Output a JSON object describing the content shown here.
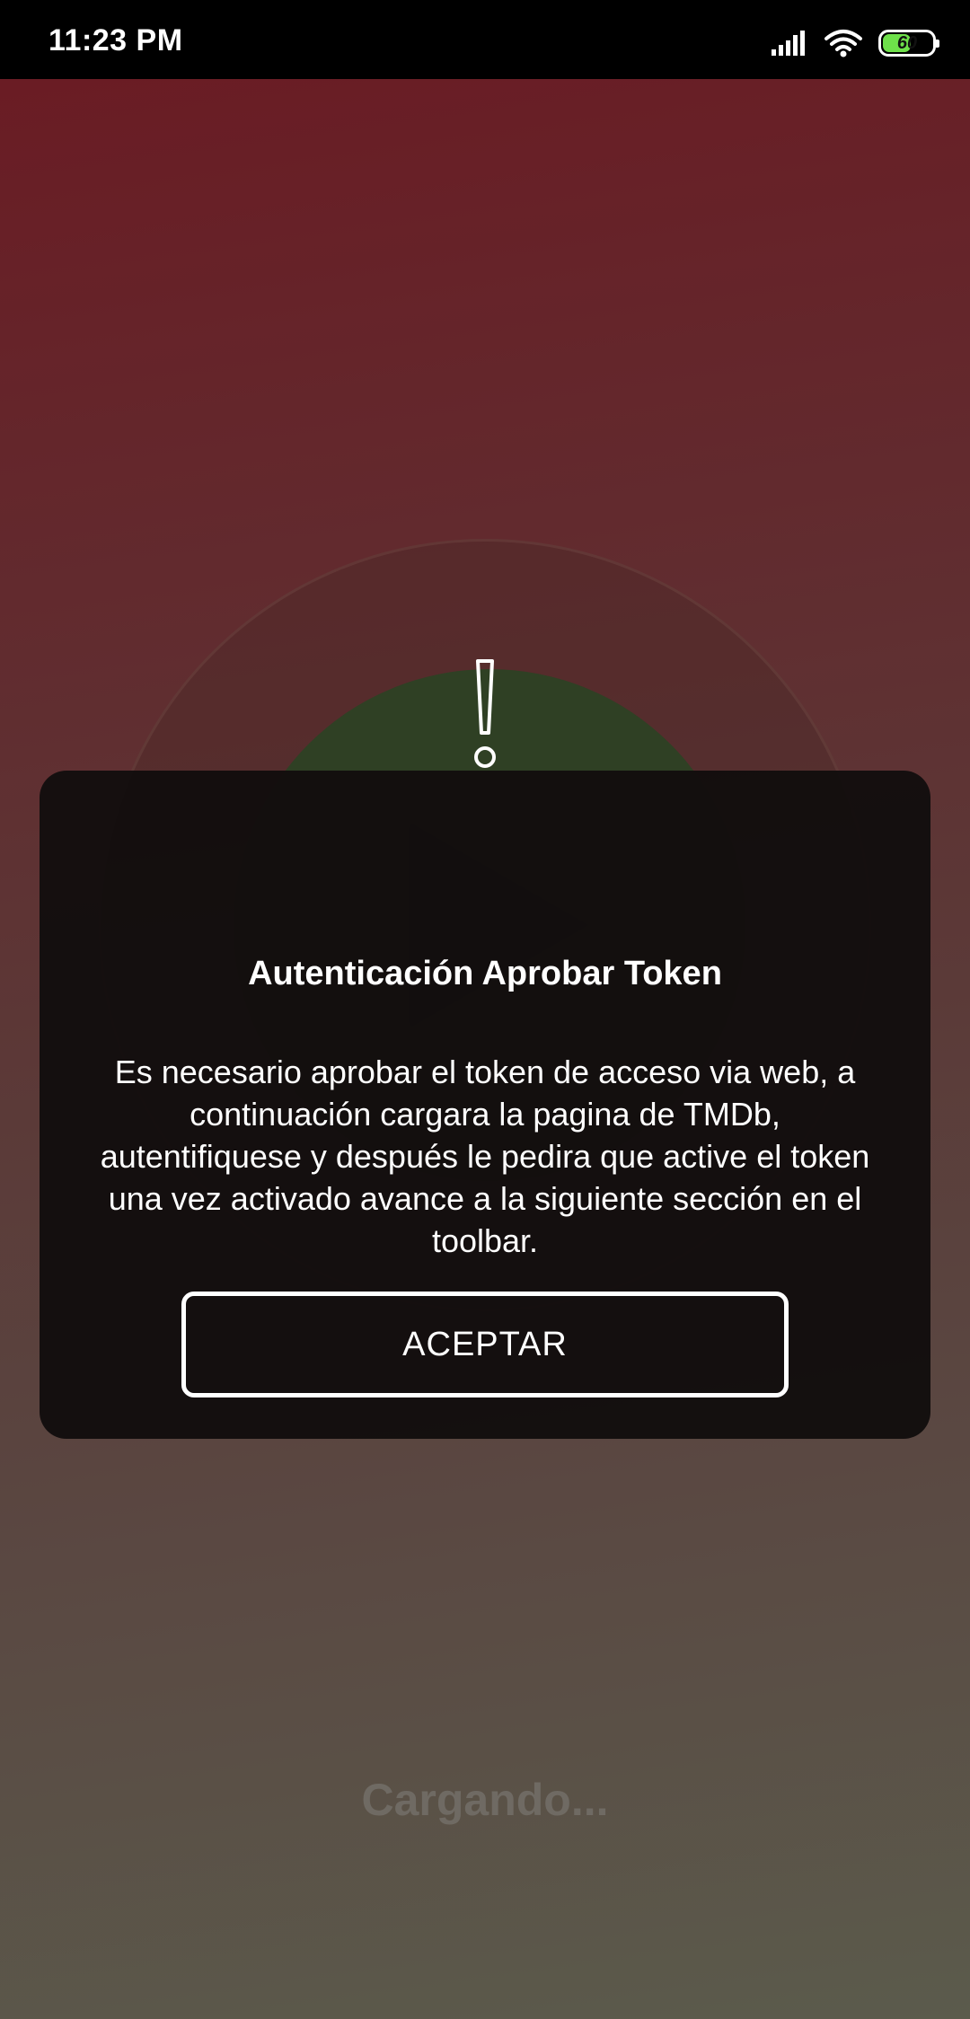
{
  "status_bar": {
    "time": "11:23 PM",
    "battery_level": "60",
    "battery_color": "#6ee04a",
    "icons": [
      "signal-icon",
      "wifi-icon",
      "battery-icon"
    ]
  },
  "background": {
    "play_icon": "play-icon",
    "loading_text": "Cargando..."
  },
  "dialog": {
    "icon": "exclamation-icon",
    "title": "Autenticación Aprobar Token",
    "message": "Es necesario aprobar el token de acceso via web, a continuación cargara la pagina de TMDb, autentifiquese y después le pedira que active el token una vez activado avance a la siguiente sección en el toolbar.",
    "accept_label": "ACEPTAR"
  }
}
